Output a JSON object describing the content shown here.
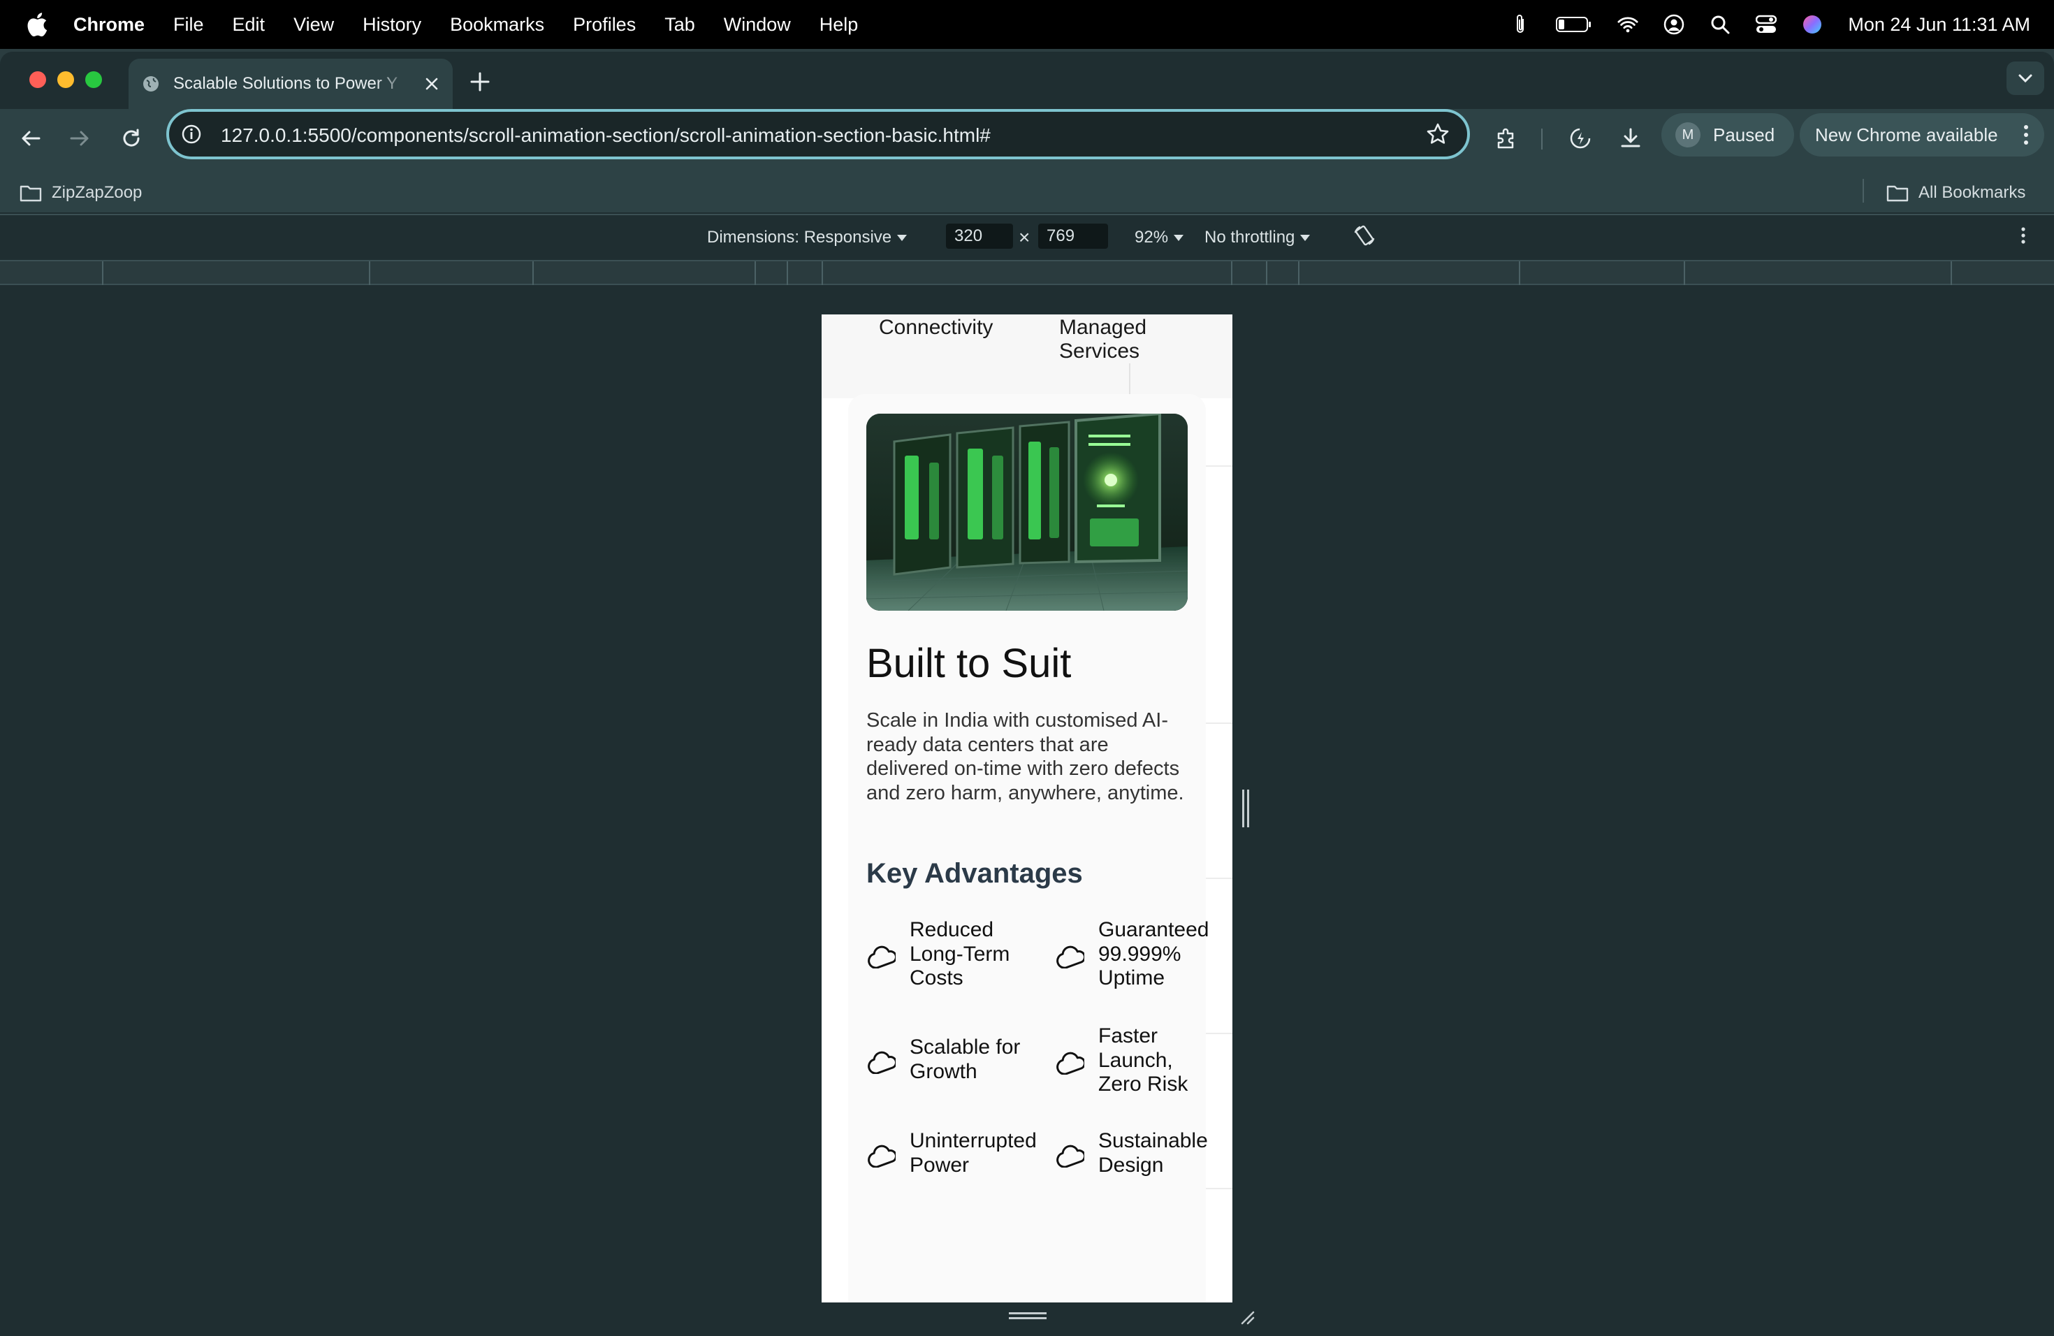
{
  "menubar": {
    "app": "Chrome",
    "menus": [
      "File",
      "Edit",
      "View",
      "History",
      "Bookmarks",
      "Profiles",
      "Tab",
      "Window",
      "Help"
    ],
    "clock": "Mon 24 Jun  11:31 AM"
  },
  "tab": {
    "title": "Scalable Solutions to Power Y"
  },
  "toolbar": {
    "url": "127.0.0.1:5500/components/scroll-animation-section/scroll-animation-section-basic.html#",
    "profile_initial": "M",
    "profile_status": "Paused",
    "update_label": "New Chrome available"
  },
  "bookmarks": {
    "folder": "ZipZapZoop",
    "all": "All Bookmarks"
  },
  "devtools": {
    "dimensions_label": "Dimensions: Responsive",
    "width": "320",
    "times": "×",
    "height": "769",
    "zoom": "92%",
    "throttling": "No throttling"
  },
  "page": {
    "nav": {
      "item1": "Connectivity",
      "item2_line1": "Managed",
      "item2_line2": "Services"
    },
    "title": "Built to Suit",
    "description": "Scale in India with customised AI-ready data centers that are delivered on-time with zero defects and zero harm, anywhere, anytime.",
    "advantages_heading": "Key Advantages",
    "advantages": [
      [
        "Reduced",
        "Long-Term",
        "Costs"
      ],
      [
        "Guaranteed",
        "99.999%",
        "Uptime"
      ],
      [
        "Scalable for",
        "Growth"
      ],
      [
        "Faster",
        "Launch,",
        "Zero Risk"
      ],
      [
        "Uninterrupted",
        "Power"
      ],
      [
        "Sustainable",
        "Design"
      ]
    ]
  }
}
